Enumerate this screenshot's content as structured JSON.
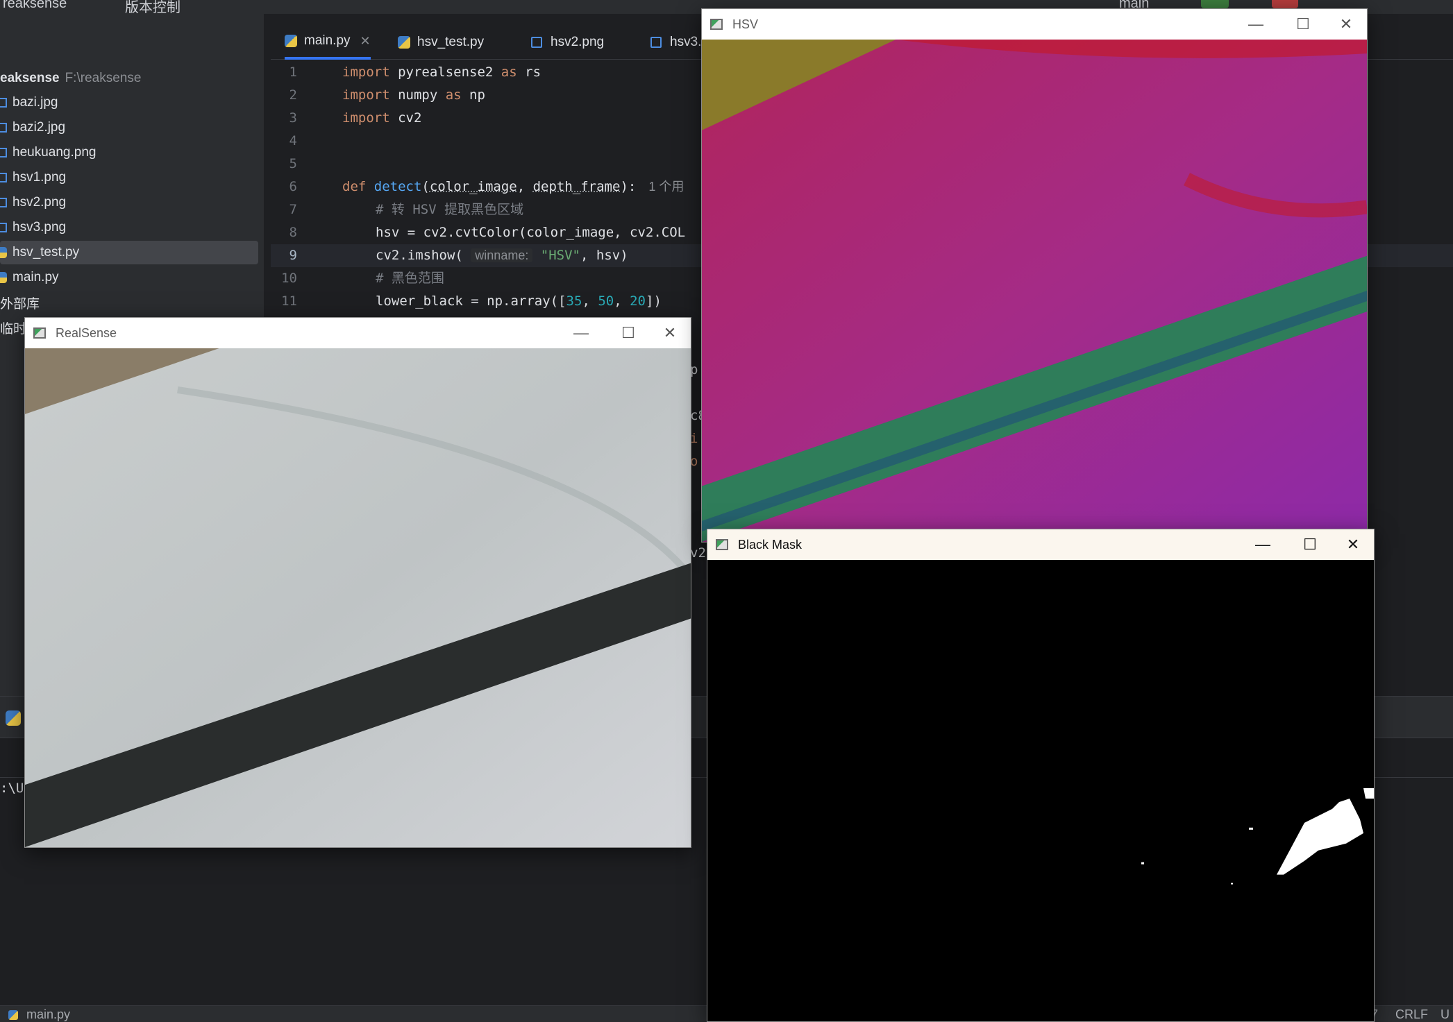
{
  "ide": {
    "project_name": "reaksense",
    "vcs_menu": "版本控制",
    "branch": "main"
  },
  "project_tree": {
    "root_name": "eaksense",
    "root_path": "F:\\reaksense",
    "items": [
      {
        "label": "bazi.jpg",
        "kind": "image"
      },
      {
        "label": "bazi2.jpg",
        "kind": "image"
      },
      {
        "label": "heukuang.png",
        "kind": "image"
      },
      {
        "label": "hsv1.png",
        "kind": "image"
      },
      {
        "label": "hsv2.png",
        "kind": "image"
      },
      {
        "label": "hsv3.png",
        "kind": "image"
      },
      {
        "label": "hsv_test.py",
        "kind": "python",
        "selected": true
      },
      {
        "label": "main.py",
        "kind": "python"
      }
    ],
    "external_libs": "外部库",
    "scratches": "临时文"
  },
  "editor": {
    "tabs": [
      {
        "label": "main.py",
        "kind": "python",
        "active": true
      },
      {
        "label": "hsv_test.py",
        "kind": "python"
      },
      {
        "label": "hsv2.png",
        "kind": "image"
      },
      {
        "label": "hsv3.",
        "kind": "image"
      }
    ],
    "line_numbers": [
      "1",
      "2",
      "3",
      "4",
      "5",
      "6",
      "7",
      "8",
      "9",
      "10",
      "11"
    ],
    "code": {
      "l1": {
        "kw1": "import",
        "mod": " pyrealsense2 ",
        "kw2": "as",
        "alias": " rs"
      },
      "l2": {
        "kw1": "import",
        "mod": " numpy ",
        "kw2": "as",
        "alias": " np"
      },
      "l3": {
        "kw1": "import",
        "mod": " cv2"
      },
      "l6": {
        "kw": "def",
        "fn": "detect",
        "p1": "color_image",
        "p2": "depth_frame",
        "usage": "1 个用"
      },
      "l7": "# 转 HSV 提取黑色区域",
      "l8": "hsv = cv2.cvtColor(color_image, cv2.COL",
      "l9": {
        "pre": "cv2.imshow(",
        "hint": "winname:",
        "arg": "\"HSV\"",
        "post": ", hsv)"
      },
      "l10": "# 黑色范围",
      "l11": {
        "pre": "lower_black = np.array([",
        "n1": "35",
        "n2": "50",
        "n3": "20",
        "post": "])"
      },
      "partial": [
        "p",
        "c8",
        "i",
        "o",
        ")",
        "v2"
      ]
    }
  },
  "run_panel": {
    "output_fragment": ":\\U"
  },
  "statusbar": {
    "file": "main.py",
    "encoding_fragment": "7",
    "line_ending": "CRLF",
    "extra": "U"
  },
  "windows": {
    "realsense": {
      "title": "RealSense"
    },
    "hsv": {
      "title": "HSV"
    },
    "black_mask": {
      "title": "Black Mask"
    },
    "controls": {
      "minimize": "—",
      "maximize": "☐",
      "close": "✕"
    }
  }
}
